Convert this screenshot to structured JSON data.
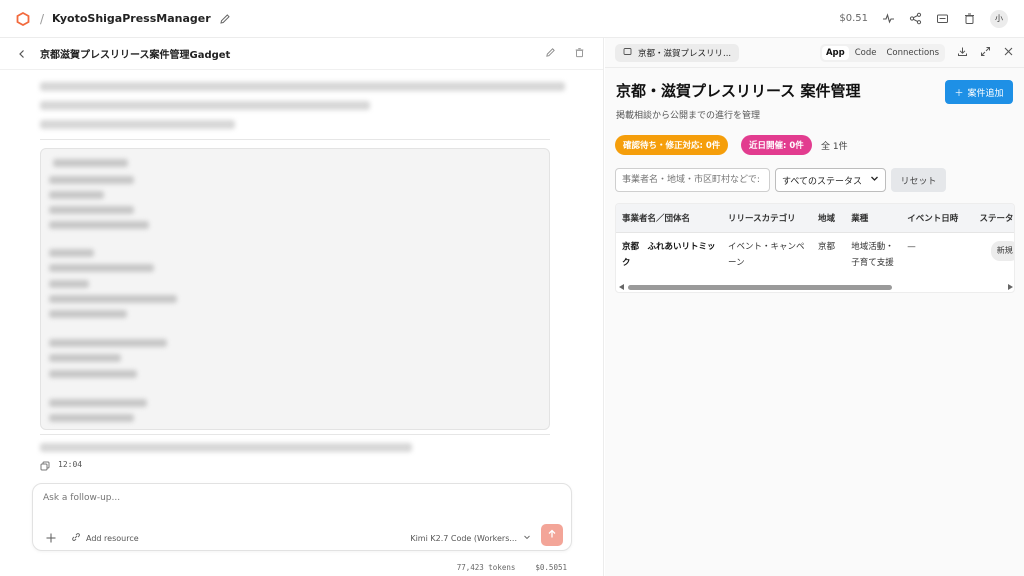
{
  "header": {
    "separator": "/",
    "project_title": "KyotoShigaPressManager",
    "cost": "$0.51",
    "avatar_initial": "小"
  },
  "chat": {
    "title": "京都滋賀プレスリリース案件管理Gadget",
    "timestamp": "12:04",
    "composer_placeholder": "Ask a follow-up...",
    "add_resource_label": "Add resource",
    "model_label": "Kimi K2.7 Code (Workers...",
    "tokens": "77,423 tokens",
    "total_cost": "$0.5051"
  },
  "preview": {
    "tab_label": "京都・滋賀プレスリリ...",
    "segments": [
      "App",
      "Code",
      "Connections"
    ],
    "active_segment": "App"
  },
  "app": {
    "title": "京都・滋賀プレスリリース 案件管理",
    "subtitle": "掲載相談から公開までの進行を管理",
    "add_button": "案件追加",
    "badge_pending": "確認待ち・修正対応: 0件",
    "badge_upcoming": "近日開催: 0件",
    "total_count": "全 1件",
    "search_placeholder": "事業者名・地域・市区町村などで:",
    "status_select": "すべてのステータス",
    "reset_button": "リセット",
    "table": {
      "columns": [
        "事業者名／団体名",
        "リリースカテゴリ",
        "地域",
        "業種",
        "イベント日時",
        "ステータス"
      ],
      "rows": [
        {
          "name": "京都　ふれあいリトミック",
          "category": "イベント・キャンペーン",
          "region": "京都",
          "industry": "地域活動・子育て支援",
          "event_date": "—",
          "status": "新規"
        }
      ]
    }
  },
  "colors": {
    "brand_orange": "#f26a3d",
    "primary_blue": "#1e90e6",
    "badge_orange": "#f59e0b",
    "badge_pink": "#e23c8f",
    "send_button": "#f3a598"
  }
}
